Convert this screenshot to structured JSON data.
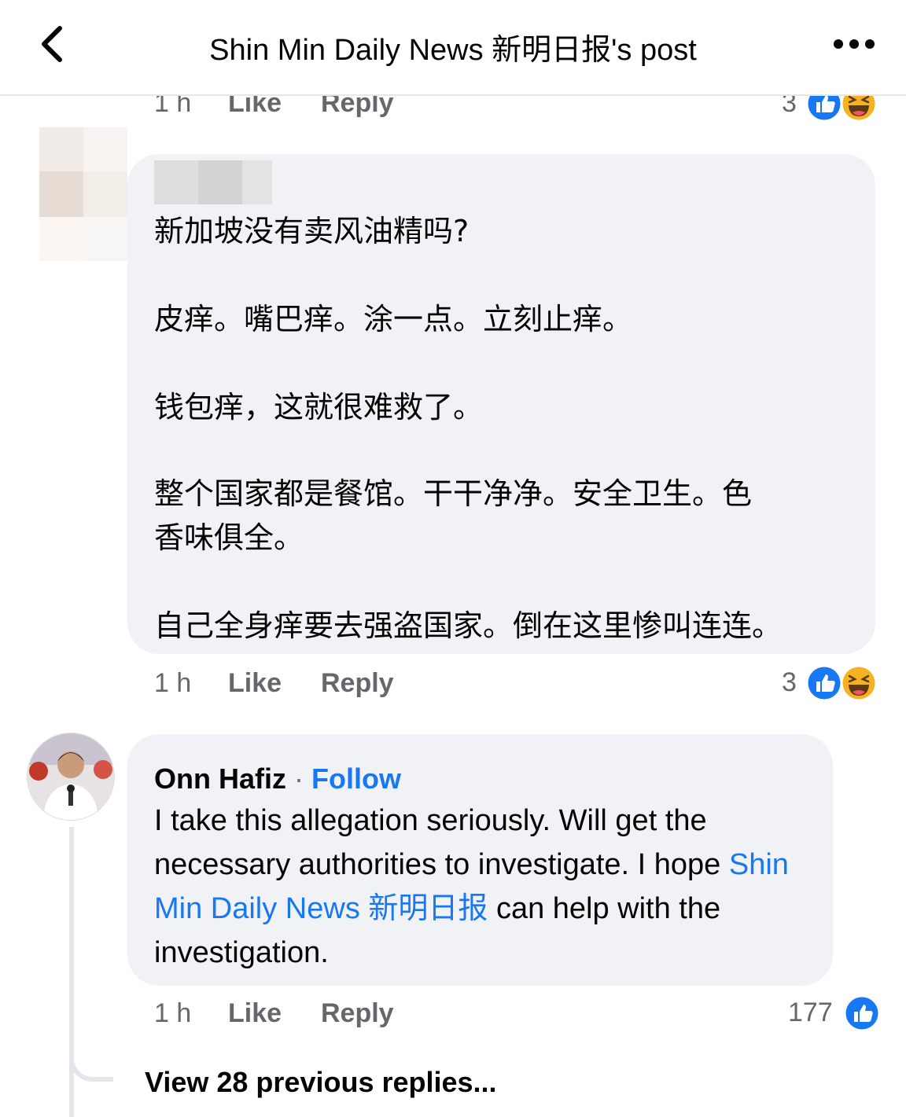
{
  "header": {
    "title": "Shin Min Daily News 新明日报's post",
    "back_icon": "chevron-left-icon",
    "more_icon": "more-dots-icon"
  },
  "prev_comment_footer": {
    "time": "1 h",
    "like": "Like",
    "reply": "Reply",
    "reaction_count": "3"
  },
  "comment1": {
    "lines": [
      "新加坡没有卖风油精吗?",
      "皮痒。嘴巴痒。涂一点。立刻止痒。",
      "钱包痒，这就很难救了。",
      "整个国家都是餐馆。干干净净。安全卫生。色",
      "香味俱全。",
      "自己全身痒要去强盗国家。倒在这里惨叫连连。"
    ],
    "time": "1 h",
    "like": "Like",
    "reply": "Reply",
    "reaction_count": "3",
    "reactions": [
      "like-reaction-icon",
      "haha-reaction-icon"
    ]
  },
  "comment2": {
    "author": "Onn Hafiz",
    "separator": "·",
    "follow": "Follow",
    "text_before": "I take this allegation seriously. Will get the necessary authorities to investigate. I hope ",
    "mention": "Shin Min Daily News 新明日报",
    "text_after": " can help with the investigation.",
    "time": "1 h",
    "like": "Like",
    "reply": "Reply",
    "reaction_count": "177",
    "reactions": [
      "like-reaction-icon"
    ]
  },
  "view_previous": "View 28 previous replies...",
  "colors": {
    "link_blue": "#1877f2",
    "secondary_text": "#65676b",
    "bubble_bg": "#f0f2f5",
    "haha_yellow": "#f7b125"
  }
}
